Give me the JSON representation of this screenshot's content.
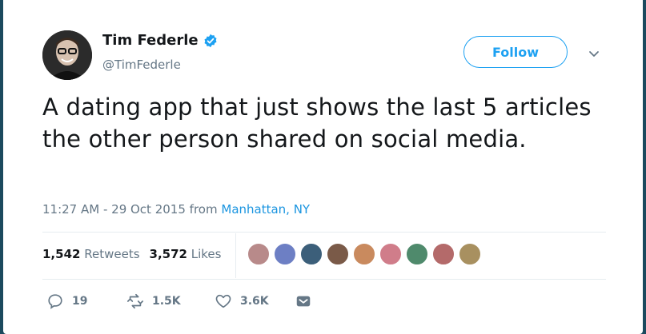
{
  "author": {
    "name": "Tim Federle",
    "handle": "@TimFederle",
    "verified": true,
    "avatar_icon": "profile-photo"
  },
  "follow_label": "Follow",
  "tweet": {
    "text": "A dating app that just shows the last 5 articles the other person shared on social media.",
    "timestamp": "11:27 AM - 29 Oct 2015",
    "from_label": "from",
    "location": "Manhattan, NY"
  },
  "stats": {
    "retweets_count": "1,542",
    "retweets_label": "Retweets",
    "likes_count": "3,572",
    "likes_label": "Likes"
  },
  "likers": [
    "#b88a8a",
    "#6d7fc4",
    "#3c5f7a",
    "#7a5a48",
    "#c98a5e",
    "#d07d8a",
    "#4f8a6c",
    "#b46a6a",
    "#a89060"
  ],
  "actions": {
    "replies": "19",
    "retweets": "1.5K",
    "likes": "3.6K"
  },
  "colors": {
    "accent": "#1da1f2",
    "link": "#1b95e0",
    "muted": "#657786",
    "background": "#1b4a5e"
  }
}
